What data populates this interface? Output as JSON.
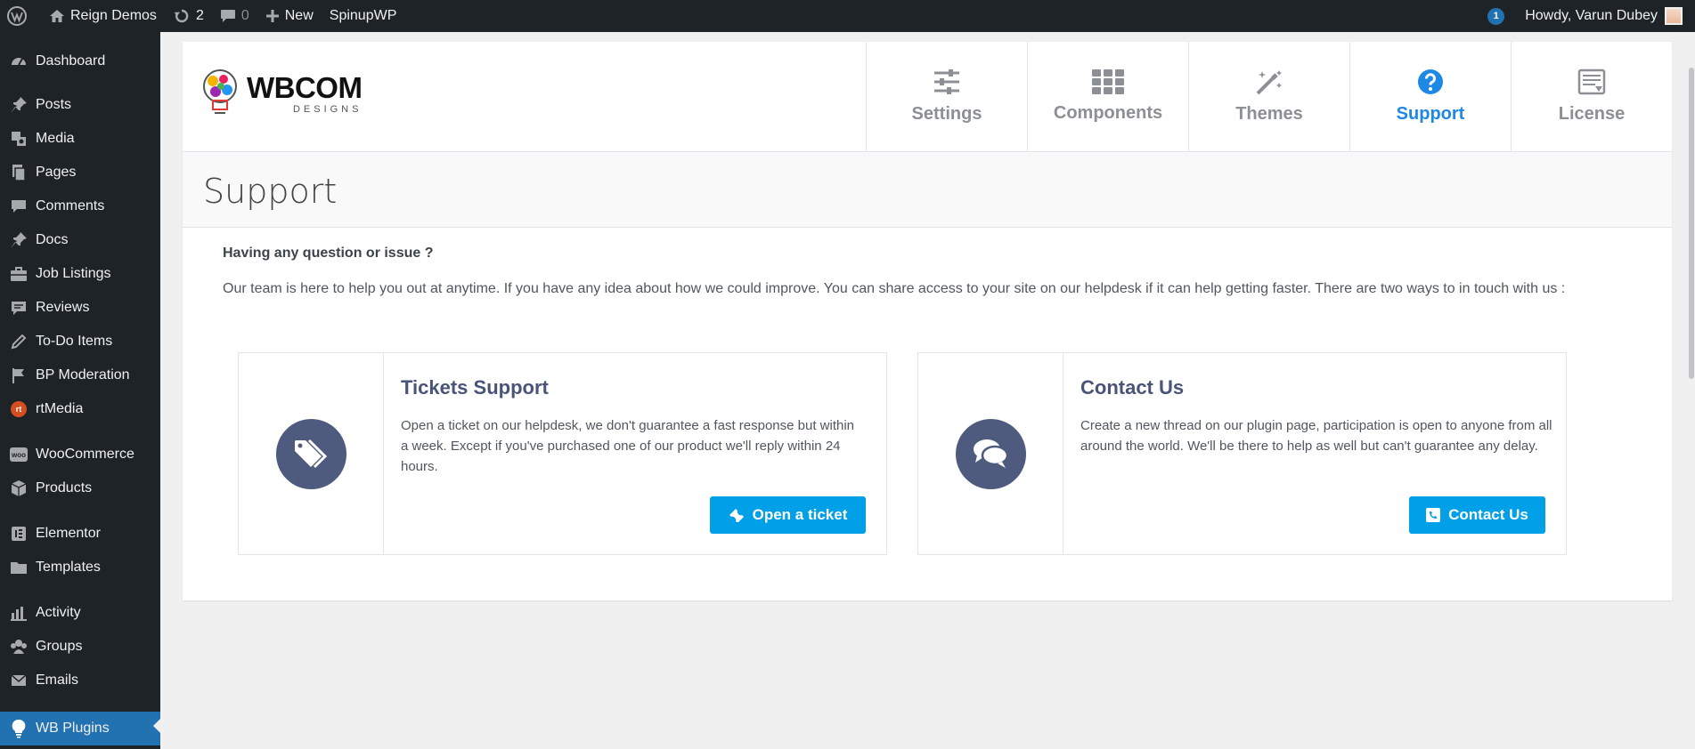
{
  "admin_bar": {
    "site_name": "Reign Demos",
    "updates_count": "2",
    "comments_count": "0",
    "new_label": "New",
    "spinup_label": "SpinupWP",
    "notification_count": "1",
    "greeting": "Howdy, Varun Dubey"
  },
  "sidebar": {
    "items": [
      {
        "label": "Dashboard",
        "icon": "dashboard-icon"
      },
      {
        "label": "Posts",
        "icon": "pin-icon"
      },
      {
        "label": "Media",
        "icon": "media-icon"
      },
      {
        "label": "Pages",
        "icon": "pages-icon"
      },
      {
        "label": "Comments",
        "icon": "comment-icon"
      },
      {
        "label": "Docs",
        "icon": "pin-icon"
      },
      {
        "label": "Job Listings",
        "icon": "briefcase-icon"
      },
      {
        "label": "Reviews",
        "icon": "reviews-icon"
      },
      {
        "label": "To-Do Items",
        "icon": "pencil-icon"
      },
      {
        "label": "BP Moderation",
        "icon": "flag-icon"
      },
      {
        "label": "rtMedia",
        "icon": "rtmedia-icon"
      },
      {
        "label": "WooCommerce",
        "icon": "woocommerce-icon"
      },
      {
        "label": "Products",
        "icon": "box-icon"
      },
      {
        "label": "Elementor",
        "icon": "elementor-icon"
      },
      {
        "label": "Templates",
        "icon": "folder-icon"
      },
      {
        "label": "Activity",
        "icon": "activity-icon"
      },
      {
        "label": "Groups",
        "icon": "groups-icon"
      },
      {
        "label": "Emails",
        "icon": "email-icon"
      },
      {
        "label": "WB Plugins",
        "icon": "lightbulb-icon"
      }
    ],
    "rtmedia_badge": "rt",
    "woo_badge": "woo"
  },
  "logo": {
    "title": "WBCOM",
    "subtitle": "DESIGNS"
  },
  "tabs": [
    {
      "label": "Settings",
      "icon": "sliders-icon"
    },
    {
      "label": "Components",
      "icon": "grid-icon"
    },
    {
      "label": "Themes",
      "icon": "magic-wand-icon"
    },
    {
      "label": "Support",
      "icon": "question-icon"
    },
    {
      "label": "License",
      "icon": "license-icon"
    }
  ],
  "selected_tab": "Support",
  "page": {
    "title": "Support",
    "question": "Having any question or issue ?",
    "intro": "Our team is here to help you out at anytime. If you have any idea about how we could improve. You can share access to your site on our helpdesk if it can help getting faster. There are two ways to in touch with us :"
  },
  "cards": [
    {
      "title": "Tickets Support",
      "description": "Open a ticket on our helpdesk, we don't guarantee a fast response but within a week. Except if you've purchased one of our product we'll reply within 24 hours.",
      "button": "Open a ticket",
      "icon": "tags-icon"
    },
    {
      "title": "Contact Us",
      "description": "Create a new thread on our plugin page, participation is open to anyone from all around the world. We'll be there to help as well but can't guarantee any delay.",
      "button": "Contact Us",
      "icon": "chat-bubbles-icon"
    }
  ],
  "colors": {
    "accent": "#1e88e5",
    "button": "#00a0e8",
    "admin_dark": "#1d2327",
    "active_menu": "#2271b1",
    "card_icon_bg": "#4e5b7e"
  }
}
